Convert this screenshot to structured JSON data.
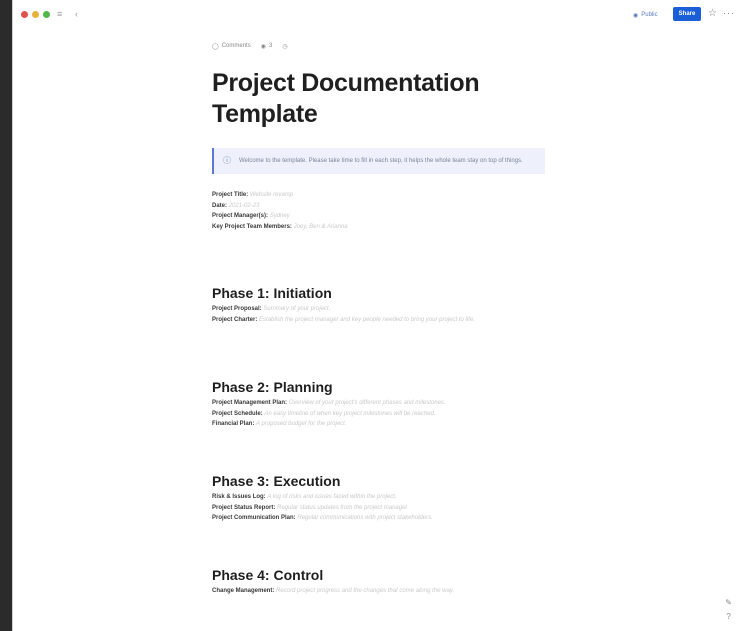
{
  "toolbar": {
    "traffic_colors": [
      "#e0524a",
      "#e7b13c",
      "#4fb848"
    ],
    "public_label": "Public",
    "share_label": "Share"
  },
  "doc": {
    "meta": {
      "comments": "Comments",
      "views": "3"
    },
    "title_line1": "Project Documentation",
    "title_line2": "Template",
    "callout": "Welcome to the template. Please take time to fill in each step, it helps the whole team stay on top of things.",
    "fields": [
      {
        "label": "Project Title:",
        "value": "Website revamp"
      },
      {
        "label": "Date:",
        "value": "2021-02-23"
      },
      {
        "label": "Project Manager(s):",
        "value": "Sydney"
      },
      {
        "label": "Key Project Team Members:",
        "value": "Joey, Ben & Arianna"
      }
    ],
    "phases": [
      {
        "title": "Phase 1: Initiation",
        "items": [
          {
            "label": "Project Proposal:",
            "value": "Summary of your project."
          },
          {
            "label": "Project Charter:",
            "value": "Establish the project manager and key people needed to bring your project to life."
          }
        ]
      },
      {
        "title": "Phase 2: Planning",
        "items": [
          {
            "label": "Project Management Plan:",
            "value": "Overview of your project's different phases and milestones."
          },
          {
            "label": "Project Schedule:",
            "value": "An easy timeline of when key project milestones will be reached."
          },
          {
            "label": "Financial Plan:",
            "value": "A proposed budget for the project."
          }
        ]
      },
      {
        "title": "Phase 3: Execution",
        "items": [
          {
            "label": "Risk & Issues Log:",
            "value": "A log of risks and issues faced within the project."
          },
          {
            "label": "Project Status Report:",
            "value": "Regular status updates from the project manager."
          },
          {
            "label": "Project Communication Plan:",
            "value": "Regular communications with project stakeholders."
          }
        ]
      },
      {
        "title": "Phase 4: Control",
        "items": [
          {
            "label": "Change Management:",
            "value": "Record project progress and the changes that come along the way."
          }
        ]
      }
    ]
  },
  "right_rail": {
    "help": "?"
  }
}
